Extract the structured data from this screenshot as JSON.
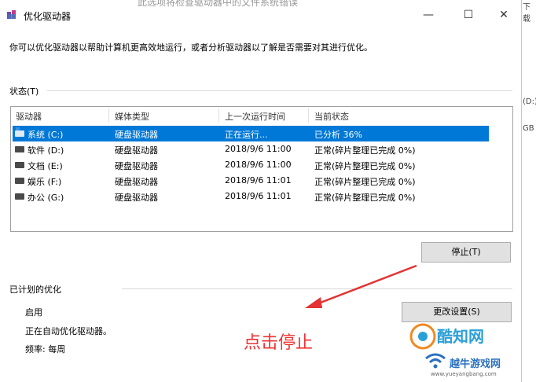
{
  "window": {
    "title": "优化驱动器",
    "bg_title": "此选项将检查驱动器中的文件系统错误",
    "minimize": "—",
    "maximize": "☐",
    "close": "✕"
  },
  "description": "你可以优化驱动器以帮助计算机更高效地运行，或者分析驱动器以了解是否需要对其进行优化。",
  "status": {
    "label": "状态(T)",
    "columns": [
      "驱动器",
      "媒体类型",
      "上一次运行时间",
      "当前状态"
    ],
    "rows": [
      {
        "drive": "系统 (C:)",
        "media": "硬盘驱动器",
        "last_run": "正在运行...",
        "state": "已分析 36%",
        "selected": true
      },
      {
        "drive": "软件 (D:)",
        "media": "硬盘驱动器",
        "last_run": "2018/9/6 11:00",
        "state": "正常(碎片整理已完成 0%)"
      },
      {
        "drive": "文档 (E:)",
        "media": "硬盘驱动器",
        "last_run": "2018/9/6 11:00",
        "state": "正常(碎片整理已完成 0%)"
      },
      {
        "drive": "娱乐 (F:)",
        "media": "硬盘驱动器",
        "last_run": "2018/9/6 11:01",
        "state": "正常(碎片整理已完成 0%)"
      },
      {
        "drive": "办公 (G:)",
        "media": "硬盘驱动器",
        "last_run": "2018/9/6 11:01",
        "state": "正常(碎片整理已完成 0%)"
      }
    ],
    "stop_button": "停止(T)"
  },
  "scheduled": {
    "label": "已计划的优化",
    "state": "启用",
    "detail": "正在自动优化驱动器。",
    "frequency": "频率: 每周",
    "change_button": "更改设置(S)"
  },
  "annotation": "点击停止",
  "watermark": {
    "line1": "酷知网",
    "line2": "越牛游戏网",
    "line3": "www.yueyangbang.com"
  },
  "side": {
    "a": "下载",
    "b": "(D:)",
    "c": "GB"
  },
  "colors": {
    "selection": "#0078d7",
    "annotation": "#e33333"
  }
}
